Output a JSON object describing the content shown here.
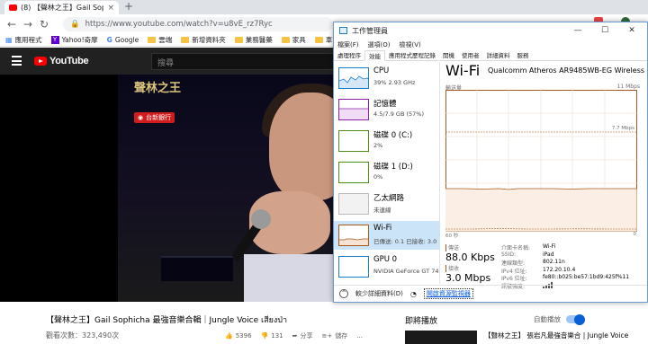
{
  "browser": {
    "tab_title": "(8) 【聲林之王】Gail Sophicha",
    "tab_close": "×",
    "new_tab": "+",
    "url": "https://www.youtube.com/watch?v=u8vE_rz7Ryc",
    "bookmarks": [
      "應用程式",
      "Yahoo!奇摩",
      "Google",
      "雲端",
      "新增資料夾",
      "業務醫藥",
      "家具",
      "車面"
    ]
  },
  "youtube": {
    "logo_text": "YouTube",
    "search_placeholder": "搜尋",
    "video": {
      "show_logo": "聲林之王",
      "sponsor": "台新銀行"
    },
    "title": "【聲林之王】Gail Sophicha 最強音樂合輯｜Jungle Voice เสียงป่า",
    "views": "觀看次數：323,490次",
    "likes": "5396",
    "dislikes": "131",
    "share": "分享",
    "save": "儲存",
    "more": "...",
    "up_next": "即將播放",
    "autoplay": "自動播放",
    "next_title": "【聲林之王】 張岩凡最強音樂合 | Jungle Voice"
  },
  "taskmanager": {
    "title": "工作管理員",
    "menu": [
      "檔案(F)",
      "選項(O)",
      "檢視(V)"
    ],
    "tabs": [
      "處理程序",
      "效能",
      "應用程式歷程記錄",
      "開機",
      "使用者",
      "詳細資料",
      "服務"
    ],
    "active_tab": "效能",
    "resources": [
      {
        "name": "CPU",
        "sub": "39%  2.93 GHz",
        "color": "#1a7ac4"
      },
      {
        "name": "記憶體",
        "sub": "4.5/7.9 GB (57%)",
        "color": "#8b1fa8"
      },
      {
        "name": "磁碟 0 (C:)",
        "sub": "2%",
        "color": "#4d8c17"
      },
      {
        "name": "磁碟 1 (D:)",
        "sub": "0%",
        "color": "#4d8c17"
      },
      {
        "name": "乙太網路",
        "sub": "未連線",
        "color": "#9a9a9a"
      },
      {
        "name": "Wi-Fi",
        "sub": "已傳送: 0.1  已接收: 3.0",
        "color": "#a7581c"
      },
      {
        "name": "GPU 0",
        "sub": "NVIDIA GeForce GT 740",
        "color": "#1a7ac4"
      }
    ],
    "selected_resource": "Wi-Fi",
    "heading": "Wi-Fi",
    "adapter": "Qualcomm Atheros AR9485WB-EG Wireless Network Adapter",
    "throughput_label": "輸送量",
    "max_label": "11 Mbps",
    "mid_label": "7.7 Mbps",
    "seconds_label": "60 秒",
    "zero_label": "0",
    "send_label": "傳送",
    "send_value": "88.0 Kbps",
    "recv_label": "接收",
    "recv_value": "3.0 Mbps",
    "details": [
      {
        "k": "介面卡名稱:",
        "v": "Wi-Fi"
      },
      {
        "k": "SSID:",
        "v": "iPad"
      },
      {
        "k": "連線類型:",
        "v": "802.11n"
      },
      {
        "k": "IPv4 位址:",
        "v": "172.20.10.4"
      },
      {
        "k": "IPv6 位址:",
        "v": "fe80::b025:be57:1bd9:425f%11"
      },
      {
        "k": "訊號強度:",
        "v": ""
      }
    ],
    "fewer_details": "較少詳細資料(D)",
    "open_monitor": "開啟資源監視器",
    "colors": {
      "wifi": "#a7581c",
      "accent": "#1a7ac4"
    }
  }
}
